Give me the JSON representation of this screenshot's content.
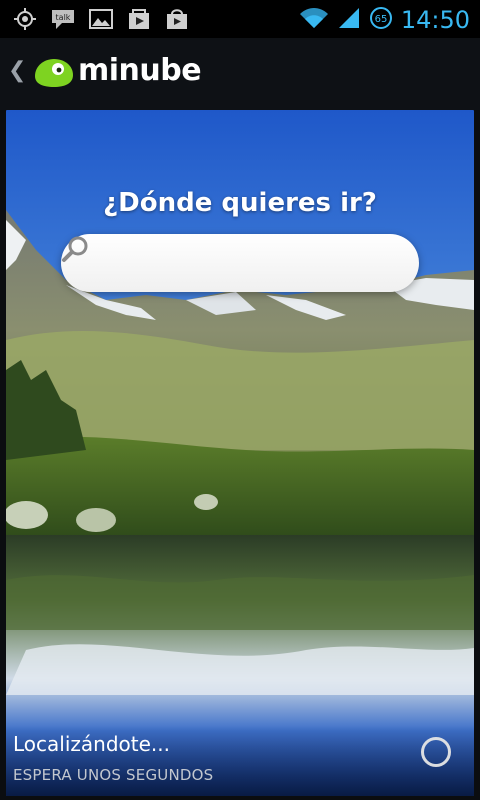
{
  "status_bar": {
    "time": "14:50",
    "battery_level": "65",
    "notifications": [
      "gps-icon",
      "talk-icon",
      "image-icon",
      "play-store-icon",
      "market-icon"
    ],
    "talk_label": "talk",
    "colors": {
      "accent": "#39b9f2"
    }
  },
  "app_bar": {
    "back_glyph": "❮",
    "brand_name": "minube",
    "brand_color": "#7ed321"
  },
  "hero": {
    "question": "¿Dónde quieres ir?",
    "search": {
      "value": "",
      "placeholder": ""
    }
  },
  "location": {
    "title": "Localizándote...",
    "subtitle": "ESPERA UNOS SEGUNDOS"
  }
}
